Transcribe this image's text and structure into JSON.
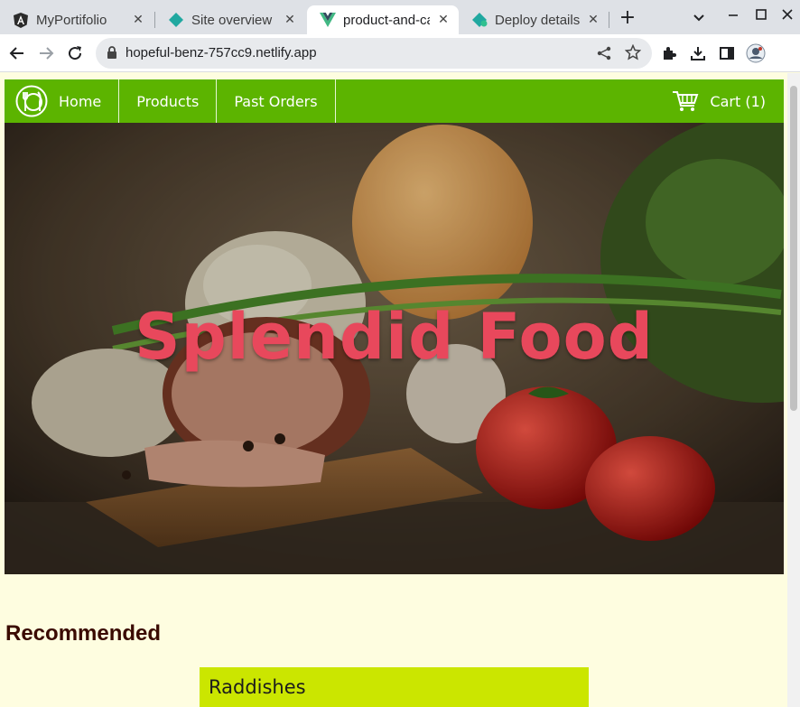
{
  "browser": {
    "tabs": [
      {
        "title": "MyPortifolio",
        "icon": "angular-icon",
        "active": false
      },
      {
        "title": "Site overview |",
        "icon": "netlify-icon",
        "active": false
      },
      {
        "title": "product-and-ca",
        "icon": "vue-icon",
        "active": true
      },
      {
        "title": "Deploy details",
        "icon": "netlify-icon",
        "active": false
      }
    ],
    "url": "hopeful-benz-757cc9.netlify.app"
  },
  "site": {
    "nav": {
      "home": "Home",
      "products": "Products",
      "past_orders": "Past Orders",
      "cart": "Cart (1)"
    },
    "hero_title": "Splendid Food",
    "section_title": "Recommended",
    "products": [
      {
        "name": "Raddishes"
      }
    ],
    "colors": {
      "nav_bg": "#5cb400",
      "page_bg": "#fefde0",
      "hero_title": "#e8485c",
      "card_bg": "#cbe600",
      "section_title": "#3a0a00"
    }
  }
}
